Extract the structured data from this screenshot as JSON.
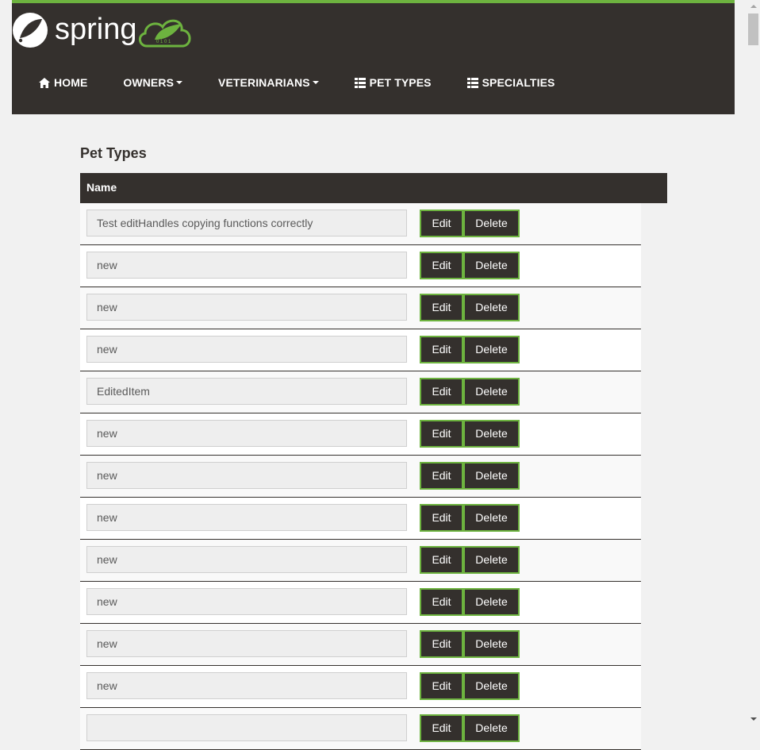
{
  "header": {
    "logo_text": "spring",
    "nav": [
      {
        "label": "HOME",
        "icon": "home-icon",
        "dropdown": false
      },
      {
        "label": "OWNERS",
        "icon": "",
        "dropdown": true
      },
      {
        "label": "VETERINARIANS",
        "icon": "",
        "dropdown": true
      },
      {
        "label": "PET TYPES",
        "icon": "list-icon",
        "dropdown": false
      },
      {
        "label": "SPECIALTIES",
        "icon": "list-icon",
        "dropdown": false
      }
    ]
  },
  "page": {
    "title": "Pet Types",
    "column_name": "Name",
    "edit_label": "Edit",
    "delete_label": "Delete",
    "rows": [
      "Test editHandles copying functions correctly",
      "new",
      "new",
      "new",
      "EditedItem",
      "new",
      "new",
      "new",
      "new",
      "new",
      "new",
      "new",
      ""
    ]
  },
  "colors": {
    "brand_dark": "#34302d",
    "brand_green": "#6db33f",
    "page_bg": "#f1f1f1"
  }
}
